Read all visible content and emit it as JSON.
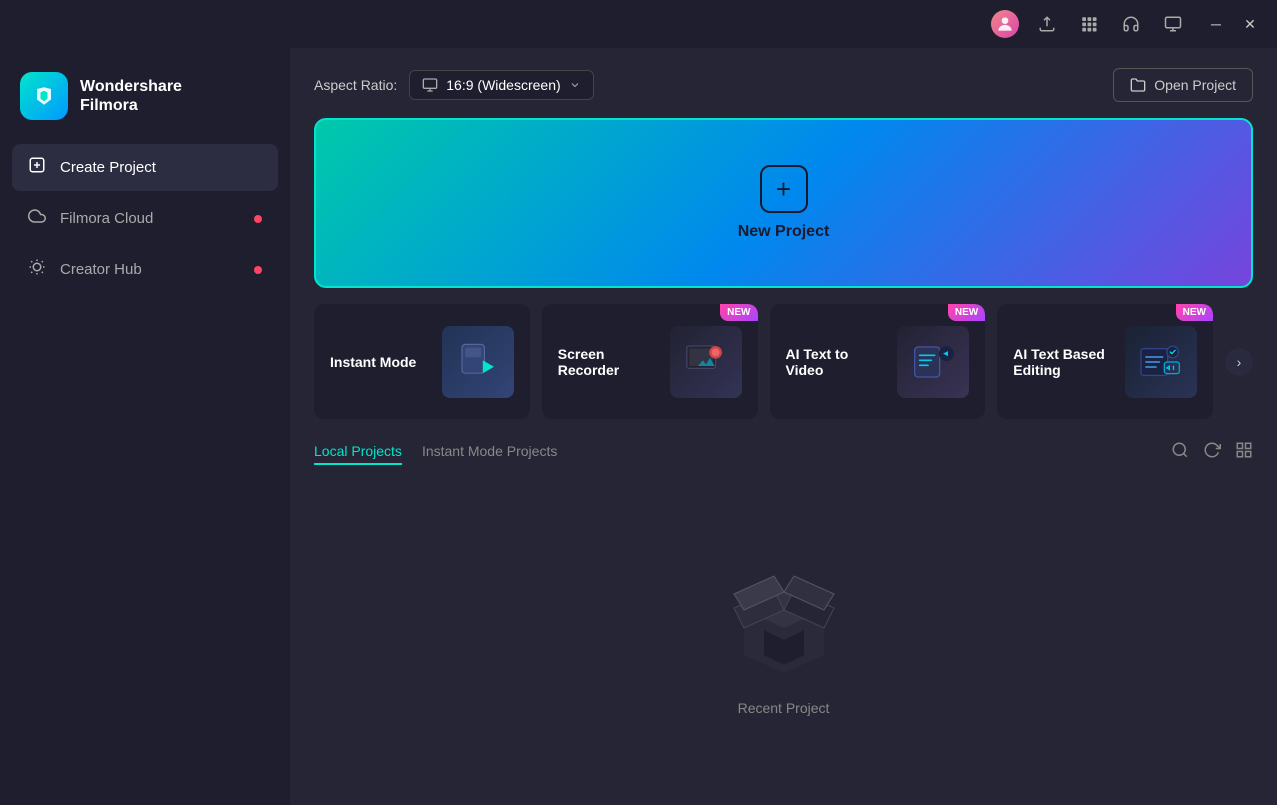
{
  "titlebar": {
    "icons": [
      "upload-icon",
      "grid-icon",
      "headset-icon",
      "camera-icon"
    ],
    "minimize_label": "─",
    "close_label": "✕"
  },
  "sidebar": {
    "brand": {
      "name_line1": "Wondershare",
      "name_line2": "Filmora"
    },
    "nav_items": [
      {
        "id": "create-project",
        "label": "Create Project",
        "icon": "➕",
        "active": true,
        "dot": false
      },
      {
        "id": "filmora-cloud",
        "label": "Filmora Cloud",
        "icon": "☁",
        "active": false,
        "dot": true
      },
      {
        "id": "creator-hub",
        "label": "Creator Hub",
        "icon": "💡",
        "active": false,
        "dot": true
      }
    ]
  },
  "content": {
    "aspect_ratio": {
      "label": "Aspect Ratio:",
      "value": "16:9 (Widescreen)",
      "icon": "🖥"
    },
    "open_project_label": "Open Project",
    "new_project_label": "New Project",
    "mode_cards": [
      {
        "id": "instant-mode",
        "label": "Instant Mode",
        "badge": null
      },
      {
        "id": "screen-recorder",
        "label": "Screen Recorder",
        "badge": "NEW"
      },
      {
        "id": "ai-text-to-video",
        "label": "AI Text to Video",
        "badge": "NEW"
      },
      {
        "id": "ai-text-based-editing",
        "label": "AI Text Based Editing",
        "badge": "NEW"
      }
    ],
    "project_tabs": [
      {
        "id": "local-projects",
        "label": "Local Projects",
        "active": true
      },
      {
        "id": "instant-mode-projects",
        "label": "Instant Mode Projects",
        "active": false
      }
    ],
    "search_icon": "🔍",
    "refresh_icon": "↻",
    "grid_icon": "⊞",
    "empty_state_label": "Recent Project"
  }
}
